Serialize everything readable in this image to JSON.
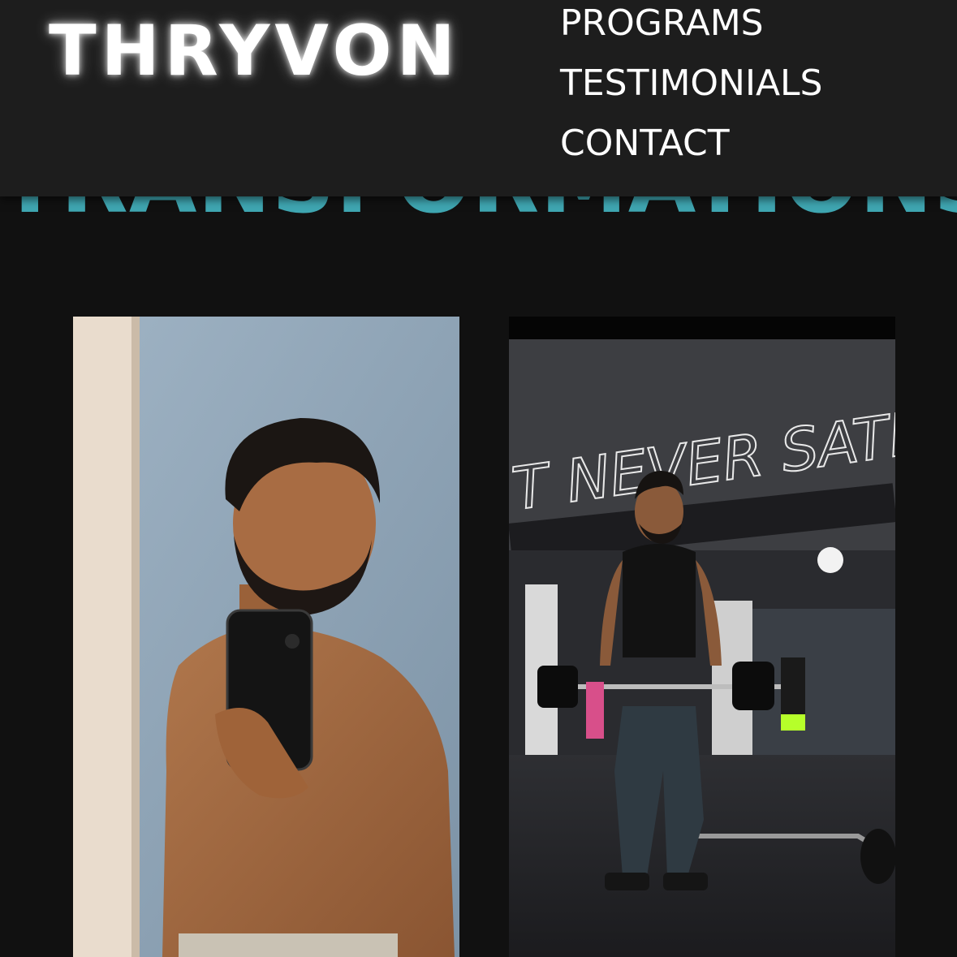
{
  "header": {
    "logo": "THRYVON",
    "nav": [
      "PROGRAMS",
      "TESTIMONIALS",
      "CONTACT"
    ]
  },
  "section": {
    "title": "TRANSFORMATIONS"
  },
  "photos": {
    "before": {
      "icon": "before-photo-image"
    },
    "after": {
      "icon": "after-photo-image",
      "wall_text": "T NEVER SATIS"
    }
  },
  "colors": {
    "background": "#111111",
    "header": "#1d1d1d",
    "accent": "#3fa6b1",
    "text": "#ffffff"
  }
}
